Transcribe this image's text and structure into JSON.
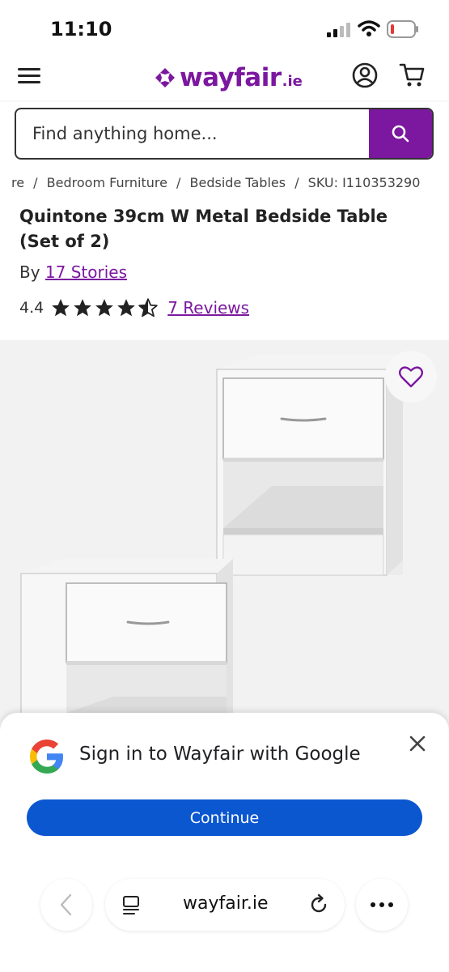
{
  "status_bar": {
    "time": "11:10"
  },
  "header": {
    "logo_text": "wayfair",
    "logo_tld": ".ie",
    "icons": [
      "menu-icon",
      "wayfair-logo-mark",
      "account-icon",
      "cart-icon"
    ]
  },
  "search": {
    "placeholder": "Find anything home...",
    "button_icon": "search-icon"
  },
  "breadcrumb": {
    "items": [
      "re",
      "Bedroom Furniture",
      "Bedside Tables"
    ],
    "separator": "/",
    "sku": "SKU: I110353290"
  },
  "product": {
    "title": "Quintone 39cm W Metal Bedside Table (Set of 2)",
    "by_label": "By",
    "brand": "17 Stories",
    "rating": "4.4",
    "rating_value": 4.4,
    "rating_max": 5,
    "reviews_link": "7 Reviews"
  },
  "signin": {
    "text": "Sign in to Wayfair with Google",
    "continue_label": "Continue"
  },
  "browser": {
    "url": "wayfair.ie"
  },
  "colors": {
    "brand_purple": "#7B189F",
    "google_blue": "#0B57D0",
    "image_background": "#F2F2F2"
  }
}
